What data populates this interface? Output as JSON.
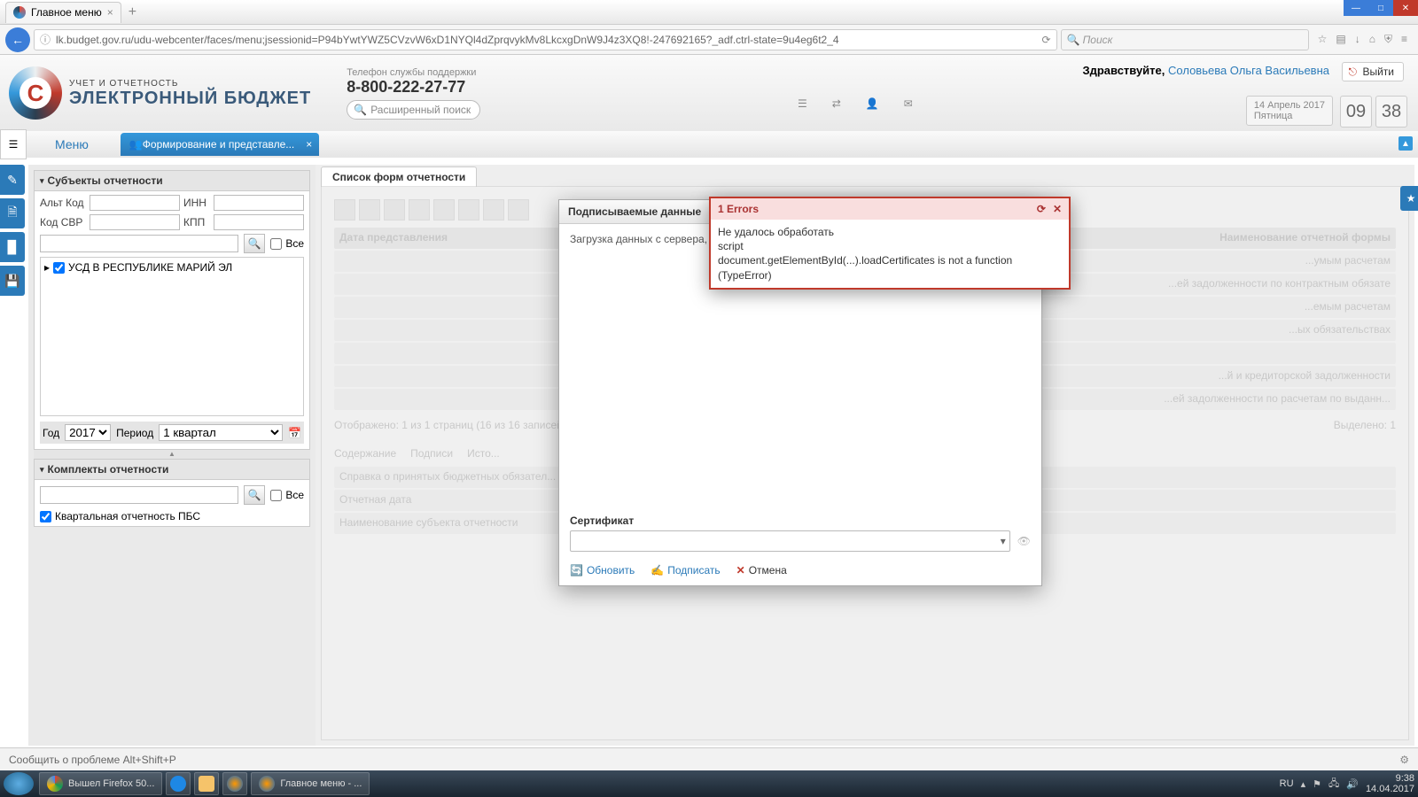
{
  "browser": {
    "tab_title": "Главное меню",
    "url": "lk.budget.gov.ru/udu-webcenter/faces/menu;jsessionid=P94bYwtYWZ5CVzvW6xD1NYQl4dZprqvykMv8LkcxgDnW9J4z3XQ8!-247692165?_adf.ctrl-state=9u4eg6t2_4",
    "search_placeholder": "Поиск"
  },
  "header": {
    "logo_sub": "УЧЕТ И ОТЧЕТНОСТЬ",
    "logo_main": "ЭЛЕКТРОННЫЙ БЮДЖЕТ",
    "phone_label": "Телефон службы поддержки",
    "phone_num": "8-800-222-27-77",
    "adv_search": "Расширенный поиск",
    "greeting_prefix": "Здравствуйте, ",
    "user_name": "Соловьева Ольга Васильевна",
    "logout": "Выйти",
    "date_line": "14 Апрель 2017",
    "weekday": "Пятница",
    "time_h": "09",
    "time_m": "38"
  },
  "menu": {
    "main": "Меню",
    "active_tab": "Формирование и представле..."
  },
  "sidebar": {
    "subjects_title": "Субъекты отчетности",
    "alt_code": "Альт Код",
    "inn": "ИНН",
    "svr_code": "Код СВР",
    "kpp": "КПП",
    "all": "Все",
    "tree_item": "УСД В РЕСПУБЛИКЕ МАРИЙ ЭЛ",
    "year_label": "Год",
    "year_value": "2017",
    "period_label": "Период",
    "period_value": "1 квартал",
    "sets_title": "Комплекты отчетности",
    "set_item": "Квартальная отчетность ПБС"
  },
  "content": {
    "list_title": "Список форм отчетности",
    "col_date": "Дата представления",
    "col_form_name": "Наименование отчетной формы",
    "pager": "Отображено: 1 из 1 страниц (16 из 16 записей)",
    "selected": "Выделено: 1",
    "ghost_rows": [
      "...умым расчетам",
      "...ей задолженности по контрактным обязате",
      "...емым расчетам",
      "...ых обязательствах",
      "",
      "...й и кредиторской задолженности",
      "...ей задолженности по расчетам по выданн..."
    ],
    "tabs": {
      "content": "Содержание",
      "signs": "Подписи",
      "hist": "Исто..."
    },
    "detail_title": "Справка о принятых бюджетных обязател...",
    "detail_rows": [
      "Отчетная дата",
      "Наименование субъекта отчетности"
    ]
  },
  "sign_dialog": {
    "title": "Подписываемые данные",
    "loading": "Загрузка данных с сервера, по...",
    "cert_label": "Сертификат",
    "refresh": "Обновить",
    "sign": "Подписать",
    "cancel": "Отмена"
  },
  "error_dialog": {
    "title": "1 Errors",
    "line1": "Не удалось обработать",
    "line2": "script",
    "line3": "document.getElementById(...).loadCertificates is not a function (TypeError)"
  },
  "status": {
    "text": "Сообщить о проблеме Alt+Shift+P"
  },
  "taskbar": {
    "chrome_title": "Вышел Firefox 50...",
    "ff_title": "Главное меню - ...",
    "lang": "RU",
    "time": "9:38",
    "date": "14.04.2017"
  }
}
